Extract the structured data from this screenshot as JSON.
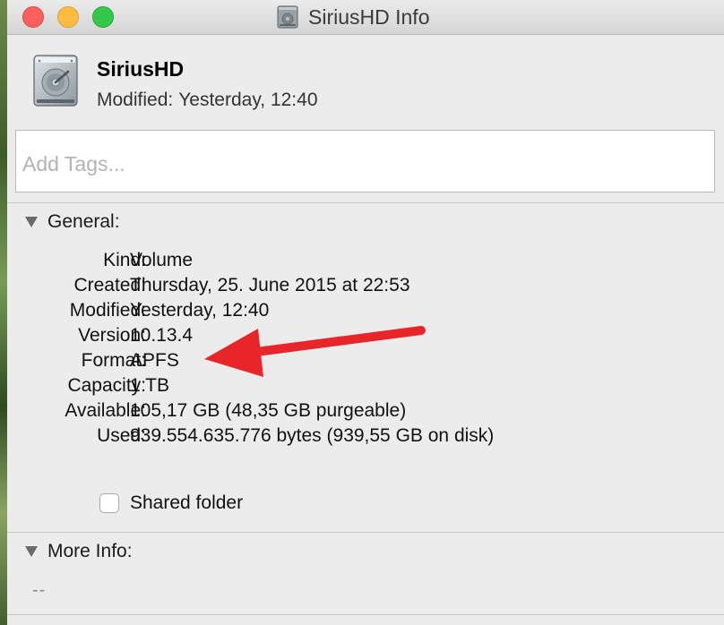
{
  "window": {
    "title": "SiriusHD Info",
    "buttons": {
      "close": "close",
      "minimize": "minimize",
      "zoom": "zoom"
    }
  },
  "header": {
    "name": "SiriusHD",
    "modified_label": "Modified:",
    "modified_value": "Yesterday, 12:40",
    "icon": "hard-drive-icon"
  },
  "tags": {
    "placeholder": "Add Tags..."
  },
  "general": {
    "label": "General:",
    "rows": [
      {
        "key": "Kind:",
        "value": "Volume"
      },
      {
        "key": "Created:",
        "value": "Thursday, 25. June 2015 at 22:53"
      },
      {
        "key": "Modified:",
        "value": "Yesterday, 12:40"
      },
      {
        "key": "Version:",
        "value": "10.13.4"
      },
      {
        "key": "Format:",
        "value": "APFS"
      },
      {
        "key": "Capacity:",
        "value": "1 TB"
      },
      {
        "key": "Available:",
        "value": "105,17 GB (48,35 GB purgeable)"
      },
      {
        "key": "Used:",
        "value": "939.554.635.776 bytes (939,55 GB on disk)"
      }
    ],
    "shared_folder_label": "Shared folder",
    "shared_folder_checked": false
  },
  "more_info": {
    "label": "More Info:",
    "value": "--"
  },
  "annotation": {
    "arrow_color": "#e8262a"
  }
}
